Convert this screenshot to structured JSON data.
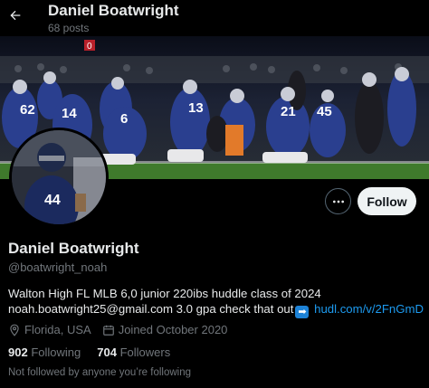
{
  "header": {
    "name": "Daniel Boatwright",
    "posts": "68 posts"
  },
  "banner": {
    "jersey_numbers": [
      "62",
      "14",
      "6",
      "13",
      "21",
      "45"
    ]
  },
  "actions": {
    "follow_label": "Follow"
  },
  "profile": {
    "display_name": "Daniel Boatwright",
    "handle": "@boatwright_noah",
    "bio_line1": "Walton High FL MLB 6,0 junior 220ibs huddle class of 2024",
    "bio_line2_text": "noah.boatwright25@gmail.com 3.0 gpa check that out",
    "bio_link": "hudl.com/v/2FnGmD",
    "location": "Florida, USA",
    "joined": "Joined October 2020",
    "following_count": "902",
    "following_label": "Following",
    "followers_count": "704",
    "followers_label": "Followers",
    "not_followed": "Not followed by anyone you’re following"
  },
  "colors": {
    "background": "#000000",
    "text": "#e7e9ea",
    "muted": "#71767b",
    "link": "#1d9bf0",
    "follow_button": "#eff3f4",
    "jersey_blue": "#2a3f8f"
  },
  "icons": {
    "back": "arrow-left-icon",
    "more": "more-dots-icon",
    "location": "location-pin-icon",
    "calendar": "calendar-icon",
    "arrow_emoji": "right-arrow-emoji-icon"
  }
}
